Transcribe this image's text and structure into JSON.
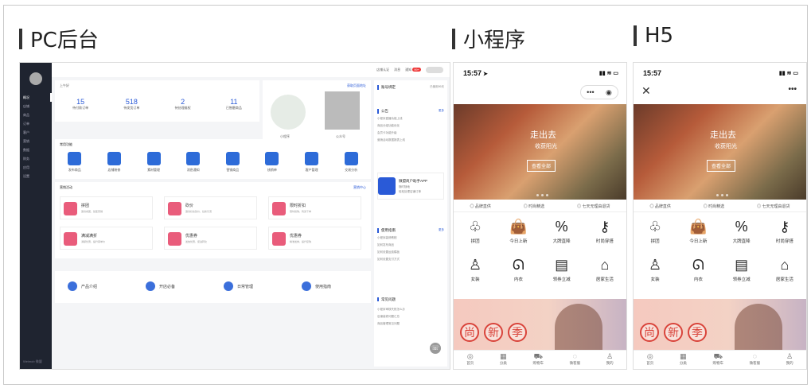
{
  "sections": {
    "pc": "PC后台",
    "mini": "小程序",
    "h5": "H5"
  },
  "pc": {
    "sidebar": [
      "概况",
      "店铺",
      "商品",
      "订单",
      "客户",
      "营销",
      "数据",
      "财务",
      "应用",
      "设置"
    ],
    "sidebar_footer": "Weimob 微盟",
    "topbar": [
      "店铺认证",
      "消息",
      "通知"
    ],
    "notice_badge": "99+",
    "greeting": "上午好",
    "stats": [
      {
        "value": "15",
        "label": "待付款订单"
      },
      {
        "value": "518",
        "label": "待发货订单"
      },
      {
        "value": "2",
        "label": "待处理维权"
      },
      {
        "value": "11",
        "label": "已售罄商品"
      }
    ],
    "qr_link": "获取页面地址",
    "qr_labels": [
      "小程序",
      "公众号"
    ],
    "common_title": "常用功能",
    "functions": [
      "发布商品",
      "店铺装修",
      "素材管理",
      "消息通知",
      "营销商品",
      "核销单",
      "客户管理",
      "交易分析"
    ],
    "marketing_title": "营销活动",
    "marketing_more": "营销中心",
    "marketing": [
      {
        "t": "拼团",
        "d": "邀请成团，裂变营销"
      },
      {
        "t": "砍价",
        "d": "邀请好友砍价，拉新引流"
      },
      {
        "t": "限时折扣",
        "d": "限时抢购，刺激下单"
      },
      {
        "t": "满减满折",
        "d": "满额优惠，提升客单价"
      },
      {
        "t": "优惠券",
        "d": "发放优惠，促进转化"
      },
      {
        "t": "优惠券",
        "d": "精准发券，提升复购"
      }
    ],
    "guides": [
      "产品介绍",
      "开店必备",
      "日常管理",
      "使用指南"
    ],
    "right": {
      "account": "账号绑定",
      "account_right": "已使用99天",
      "notice_title": "公告",
      "notice_more": "更多",
      "notices": [
        "小程序直播功能上线",
        "商品分组功能优化",
        "会员卡功能升级",
        "营销活动数据报表上线"
      ],
      "app_title": "微盟商户助手APP",
      "app_sub1": "随时随地",
      "app_sub2": "轻松处理店铺订单",
      "help_title": "使用指南",
      "help_more": "更多",
      "helps": [
        "小程序装修教程",
        "如何发布商品",
        "如何设置运费模板",
        "如何设置支付方式"
      ],
      "faq_title": "常见问题",
      "faqs": [
        "小程序审核失败怎么办",
        "店铺装修问题汇总",
        "商品管理常见问题"
      ]
    }
  },
  "phone": {
    "time": "15:57",
    "banner": {
      "title": "走出去",
      "subtitle": "收获阳光",
      "button": "查看全部"
    },
    "promises": [
      "品牌直供",
      "时尚精选",
      "七天无理由退货"
    ],
    "categories": [
      {
        "name": "拼团",
        "icon": "♧"
      },
      {
        "name": "今日上新",
        "icon": "👜"
      },
      {
        "name": "大牌直降",
        "icon": "%"
      },
      {
        "name": "时尚穿搭",
        "icon": "⚷"
      },
      {
        "name": "女装",
        "icon": "♙"
      },
      {
        "name": "内衣",
        "icon": "ᘏ"
      },
      {
        "name": "领券立减",
        "icon": "▤"
      },
      {
        "name": "居家生活",
        "icon": "⌂"
      }
    ],
    "promo_chars": [
      "尚",
      "新",
      "季"
    ],
    "tabs": [
      "首页",
      "分类",
      "购物车",
      "微客服",
      "我的"
    ],
    "tab_icons": [
      "◎",
      "▦",
      "⛟",
      "◌",
      "♙"
    ]
  }
}
